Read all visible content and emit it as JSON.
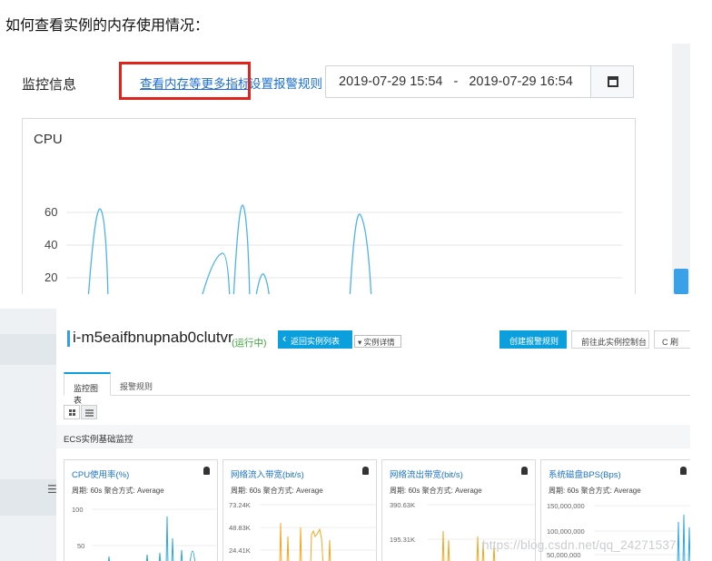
{
  "doc": {
    "heading": "如何查看实例的内存使用情况：",
    "watermark": "https://blog.csdn.net/qq_24271537"
  },
  "monitor_panel": {
    "label": "监控信息",
    "more_metrics_link": "查看内存等更多指标",
    "alarm_rules_link": "设置报警规则",
    "date_start": "2019-07-29 15:54",
    "date_separator": "-",
    "date_end": "2019-07-29 16:54",
    "calendar_icon": "calendar-icon",
    "highlight_color": "#e0241b",
    "link_color": "#1e6fd0"
  },
  "cpu_chart": {
    "title": "CPU",
    "y_ticks": [
      "60",
      "40",
      "20"
    ],
    "line_color": "#4db3ea"
  },
  "instance_page": {
    "instance_id": "i-m5eaifbnupnab0clutvr",
    "status": "(运行中)",
    "back_button": "返回实例列表",
    "detail_dropdown": "▾ 实例详情",
    "create_alarm_button": "创建报警规则",
    "console_button": "前往此实例控制台",
    "refresh_button": "C 刷",
    "accent_color": "#0ba0dd",
    "status_color": "#3aa339",
    "tabs": [
      {
        "label": "监控图表",
        "active": true
      },
      {
        "label": "报警规则",
        "active": false
      }
    ],
    "section_title": "ECS实例基础监控",
    "metric_cards": [
      {
        "title": "CPU使用率(%)",
        "meta": "周期: 60s   聚合方式: Average",
        "y_ticks": [
          "100",
          "50"
        ],
        "line_color": "#2ea7e0"
      },
      {
        "title": "网络流入带宽(bit/s)",
        "meta": "周期: 60s   聚合方式: Average",
        "y_ticks": [
          "73.24K",
          "48.83K",
          "24.41K"
        ],
        "line_color": "#f5a623"
      },
      {
        "title": "网络流出带宽(bit/s)",
        "meta": "周期: 60s   聚合方式: Average",
        "y_ticks": [
          "390.63K",
          "195.31K"
        ],
        "line_color": "#f5a623"
      },
      {
        "title": "系统磁盘BPS(Bps)",
        "meta": "周期: 60s   聚合方式: Average",
        "y_ticks": [
          "150,000,000",
          "100,000,000",
          "50,000,000"
        ],
        "line_color": "#2ea7e0"
      }
    ]
  }
}
